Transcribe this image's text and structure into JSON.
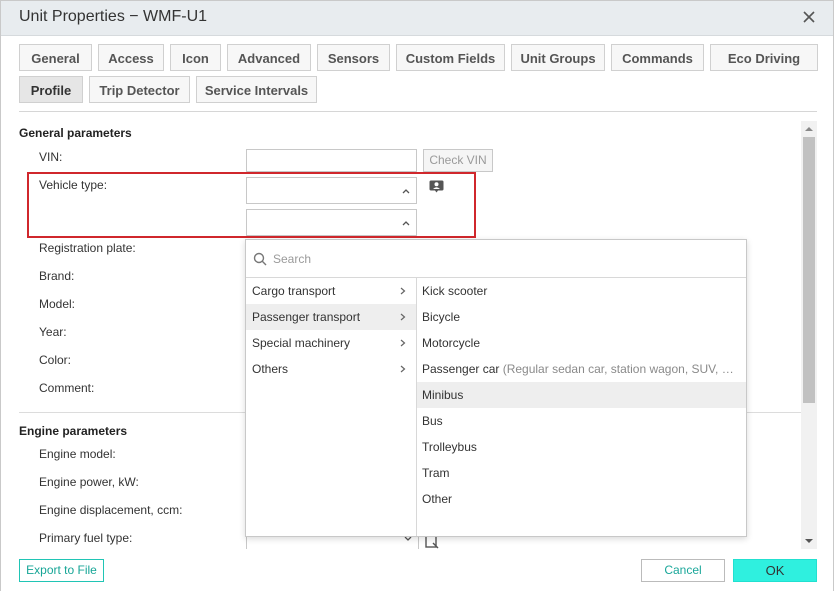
{
  "window": {
    "title": "Unit Properties − WMF-U1"
  },
  "tabs": [
    {
      "label": "General"
    },
    {
      "label": "Access"
    },
    {
      "label": "Icon"
    },
    {
      "label": "Advanced"
    },
    {
      "label": "Sensors"
    },
    {
      "label": "Custom Fields"
    },
    {
      "label": "Unit Groups"
    },
    {
      "label": "Commands"
    },
    {
      "label": "Eco Driving"
    },
    {
      "label": "Profile",
      "active": true
    },
    {
      "label": "Trip Detector"
    },
    {
      "label": "Service Intervals"
    }
  ],
  "general": {
    "title": "General parameters",
    "vin_label": "VIN:",
    "vin_value": "",
    "check_vin_button": "Check VIN",
    "vehicle_type_label": "Vehicle type:",
    "registration_label": "Registration plate:",
    "brand_label": "Brand:",
    "model_label": "Model:",
    "year_label": "Year:",
    "color_label": "Color:",
    "comment_label": "Comment:"
  },
  "engine": {
    "title": "Engine parameters",
    "model_label": "Engine model:",
    "power_label": "Engine power, kW:",
    "displacement_label": "Engine displacement, ccm:",
    "fuel_label": "Primary fuel type:"
  },
  "dropdown": {
    "search_placeholder": "Search",
    "categories": [
      {
        "label": "Cargo transport"
      },
      {
        "label": "Passenger transport",
        "active": true
      },
      {
        "label": "Special machinery"
      },
      {
        "label": "Others"
      }
    ],
    "types": [
      {
        "label": "Kick scooter",
        "desc": ""
      },
      {
        "label": "Bicycle",
        "desc": ""
      },
      {
        "label": "Motorcycle",
        "desc": ""
      },
      {
        "label": "Passenger car",
        "desc": " (Regular sedan car, station wagon, SUV, …"
      },
      {
        "label": "Minibus",
        "desc": "",
        "active": true
      },
      {
        "label": "Bus",
        "desc": ""
      },
      {
        "label": "Trolleybus",
        "desc": ""
      },
      {
        "label": "Tram",
        "desc": ""
      },
      {
        "label": "Other",
        "desc": ""
      }
    ]
  },
  "footer": {
    "export_button": "Export to File",
    "cancel_button": "Cancel",
    "ok_button": "OK"
  },
  "colors": {
    "accent": "#2ff0df",
    "highlight_border": "#d0272c",
    "link": "#16a596"
  }
}
